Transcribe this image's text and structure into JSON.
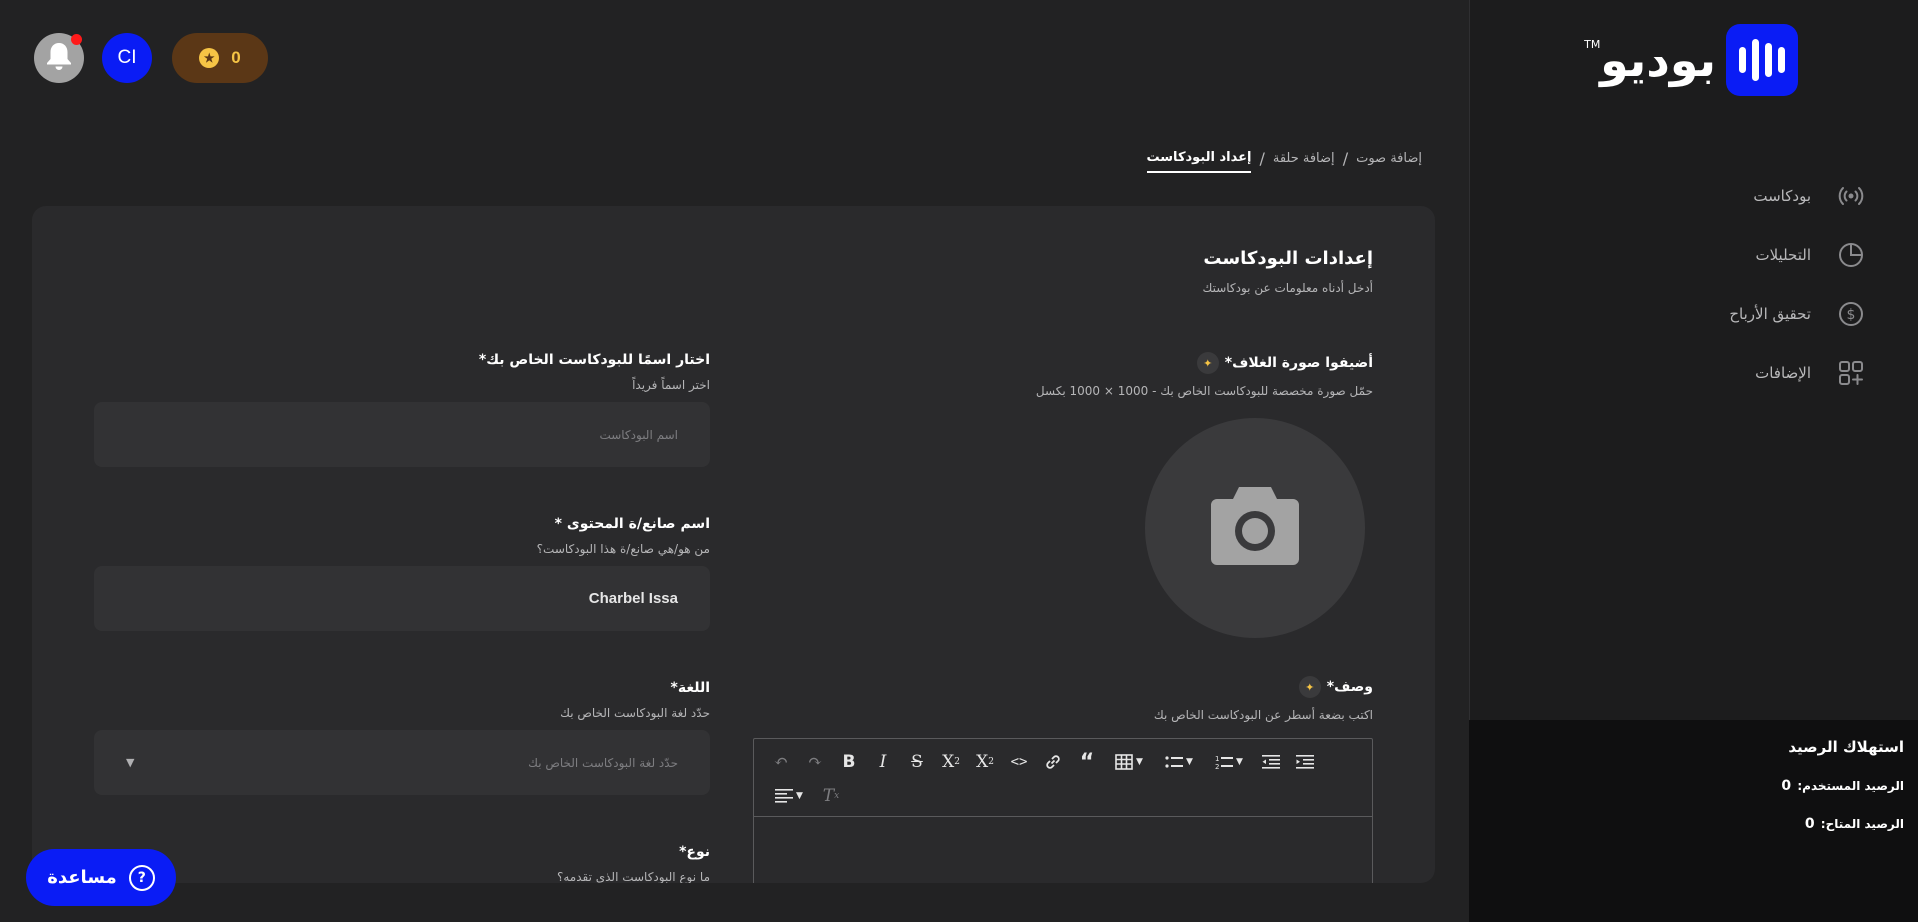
{
  "brand": {
    "name": "بوديو",
    "tm": "TM",
    "accent": "#0a1cf5"
  },
  "sidebar": {
    "items": [
      {
        "label": "بودكاست",
        "icon": "broadcast-icon"
      },
      {
        "label": "التحليلات",
        "icon": "pie-chart-icon"
      },
      {
        "label": "تحقيق الأرباح",
        "icon": "dollar-icon"
      },
      {
        "label": "الإضافات",
        "icon": "add-grid-icon"
      }
    ],
    "balance": {
      "title": "استهلاك الرصيد",
      "used_label": "الرصيد المستخدم:",
      "used_value": "0",
      "available_label": "الرصيد المتاح:",
      "available_value": "0"
    }
  },
  "topbar": {
    "avatar_initials": "CI",
    "coins": "0",
    "has_notification": true
  },
  "steps": {
    "items": [
      "إعداد البودكاست",
      "إضافة حلقة",
      "إضافة صوت"
    ],
    "separator": "/",
    "active_index": 0
  },
  "form": {
    "title": "إعدادات البودكاست",
    "subtitle": "أدخل أدناه معلومات عن بودكاستك",
    "cover": {
      "label": "أضيفوا صورة الغلاف*",
      "hint": "حمّل صورة مخصصة للبودكاست الخاص بك - 1000 × 1000 بكسل"
    },
    "description": {
      "label": "وصف*",
      "hint": "اكتب بضعة أسطر عن البودكاست الخاص بك"
    },
    "podcast_name": {
      "label": "اختار اسمًا للبودكاست الخاص بك*",
      "hint": "اختر اسماً فريداً",
      "placeholder": "اسم البودكاست"
    },
    "creator": {
      "label": "اسم صانع/ة المحتوى *",
      "hint": "من هو/هي صانع/ة هذا البودكاست؟",
      "value": "Charbel Issa"
    },
    "language": {
      "label": "اللغة*",
      "hint": "حدّد لغة البودكاست الخاص بك",
      "placeholder": "حدّد لغة البودكاست الخاص بك"
    },
    "type": {
      "label": "نوع*",
      "hint": "ما نوع البودكاست الذي تقدمه؟"
    }
  },
  "help": {
    "label": "مساعدة"
  }
}
